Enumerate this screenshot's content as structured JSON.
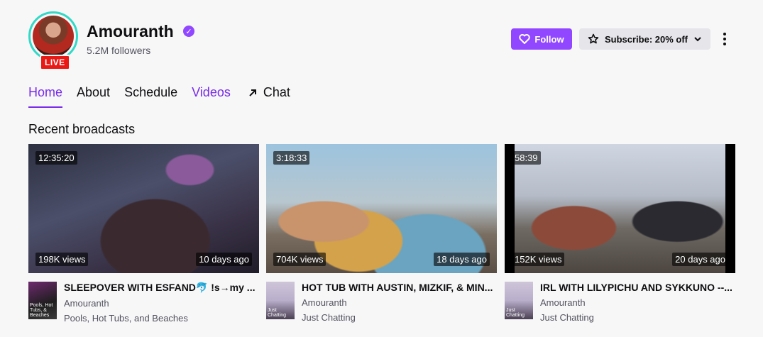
{
  "channel": {
    "name": "Amouranth",
    "followers": "5.2M followers",
    "live_label": "LIVE"
  },
  "actions": {
    "follow_label": "Follow",
    "subscribe_label": "Subscribe: 20% off"
  },
  "tabs": [
    {
      "label": "Home",
      "active": true
    },
    {
      "label": "About"
    },
    {
      "label": "Schedule"
    },
    {
      "label": "Videos"
    },
    {
      "label": "Chat"
    }
  ],
  "section": {
    "title": "Recent broadcasts"
  },
  "videos": [
    {
      "duration": "12:35:20",
      "views": "198K views",
      "date": "10 days ago",
      "title": "SLEEPOVER WITH ESFAND🐬 !s→my ...",
      "channel": "Amouranth",
      "category": "Pools, Hot Tubs, and Beaches",
      "box_art_text": "Pools, Hot Tubs, & Beaches"
    },
    {
      "duration": "3:18:33",
      "views": "704K views",
      "date": "18 days ago",
      "title": "HOT TUB WITH AUSTIN, MIZKIF, & MIN...",
      "channel": "Amouranth",
      "category": "Just Chatting",
      "box_art_text": "Just Chatting"
    },
    {
      "duration": "58:39",
      "views": "152K views",
      "date": "20 days ago",
      "title": "IRL WITH LILYPICHU AND SYKKUNO --...",
      "channel": "Amouranth",
      "category": "Just Chatting",
      "box_art_text": "Just Chatting"
    }
  ],
  "colors": {
    "accent": "#9147ff",
    "active_tab": "#772ce8",
    "live": "#e91916",
    "avatar_ring": "#33d9c6"
  }
}
